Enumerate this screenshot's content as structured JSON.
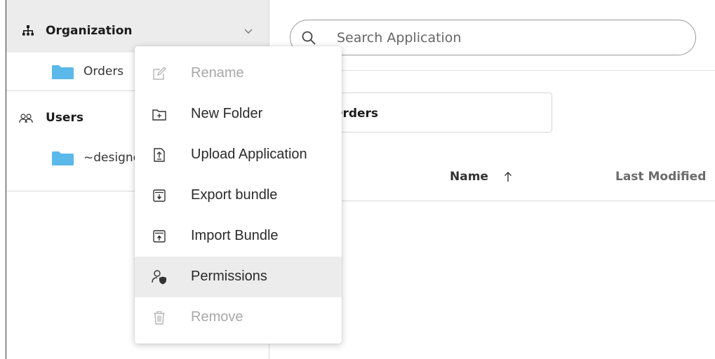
{
  "sidebar": {
    "organization": {
      "label": "Organization"
    },
    "org_folders": [
      {
        "label": "Orders"
      }
    ],
    "users": {
      "label": "Users"
    },
    "user_folders": [
      {
        "label": "~designer"
      }
    ]
  },
  "main": {
    "search": {
      "placeholder": "Search Application"
    },
    "breadcrumb": {
      "label": "Orders"
    },
    "table": {
      "columns": [
        {
          "label": "Name",
          "sort": "ascending"
        },
        {
          "label": "Last Modified"
        }
      ]
    }
  },
  "context_menu": {
    "items": [
      {
        "label": "Rename",
        "icon": "rename-icon",
        "disabled": true
      },
      {
        "label": "New Folder",
        "icon": "new-folder-icon",
        "disabled": false
      },
      {
        "label": "Upload Application",
        "icon": "upload-icon",
        "disabled": false
      },
      {
        "label": "Export bundle",
        "icon": "export-icon",
        "disabled": false
      },
      {
        "label": "Import Bundle",
        "icon": "import-icon",
        "disabled": false
      },
      {
        "label": "Permissions",
        "icon": "permissions-icon",
        "disabled": false,
        "highlighted": true
      },
      {
        "label": "Remove",
        "icon": "trash-icon",
        "disabled": true
      }
    ]
  },
  "colors": {
    "folder": "#5bb8ea",
    "sidebar_selected_bg": "#ececec",
    "menu_hover_bg": "#ececec",
    "disabled_text": "#a8a8a8"
  }
}
